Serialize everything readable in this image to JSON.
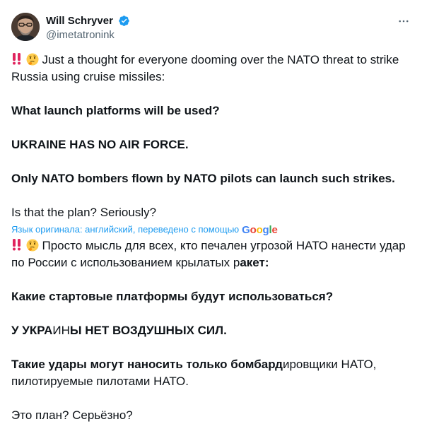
{
  "author": {
    "display_name": "Will Schryver",
    "handle": "@imetatronink",
    "verified_color": "#1d9bf0"
  },
  "icons": {
    "avatar": "avatar-portrait",
    "verified": "verified-badge-icon",
    "more": "more-options-icon",
    "emoji_bang": "double-exclamation-emoji",
    "emoji_think": "thinking-face-emoji"
  },
  "original": {
    "line1": "Just a thought for everyone dooming over the NATO threat to strike Russia using cruise missiles:",
    "question": "What launch platforms will be used?",
    "no_air_force": "UKRAINE HAS NO AIR FORCE.",
    "only_nato": "Only NATO bombers flown by NATO pilots can launch such strikes.",
    "closing": "Is that the plan? Seriously?"
  },
  "translation_note": {
    "text": "Язык оригинала: английский, переведено с помощью",
    "brand": "Google",
    "brand_colors": [
      "#4285f4",
      "#ea4335",
      "#fbbc05",
      "#4285f4",
      "#34a853",
      "#ea4335"
    ]
  },
  "translated": {
    "line1_a": "Просто мысль для всех, кто печален угрозой НАТО нанести удар по России с использованием крылатых р",
    "line1_b": "акет:",
    "question": "Какие стартовые платформы бу",
    "question_b": "д",
    "question_c": "ут использоваться?",
    "no_air_force_a": "У УКРА",
    "no_air_force_b": "ИН",
    "no_air_force_c": "Ы НЕТ ВОЗДУШНЫХ СИЛ.",
    "only_nato_a": "Такие удары могут наносить только бомбард",
    "only_nato_b": "ировщики НАТО, пилотируемые пилотами НАТО.",
    "closing": "Это план? Серьёзно?"
  }
}
